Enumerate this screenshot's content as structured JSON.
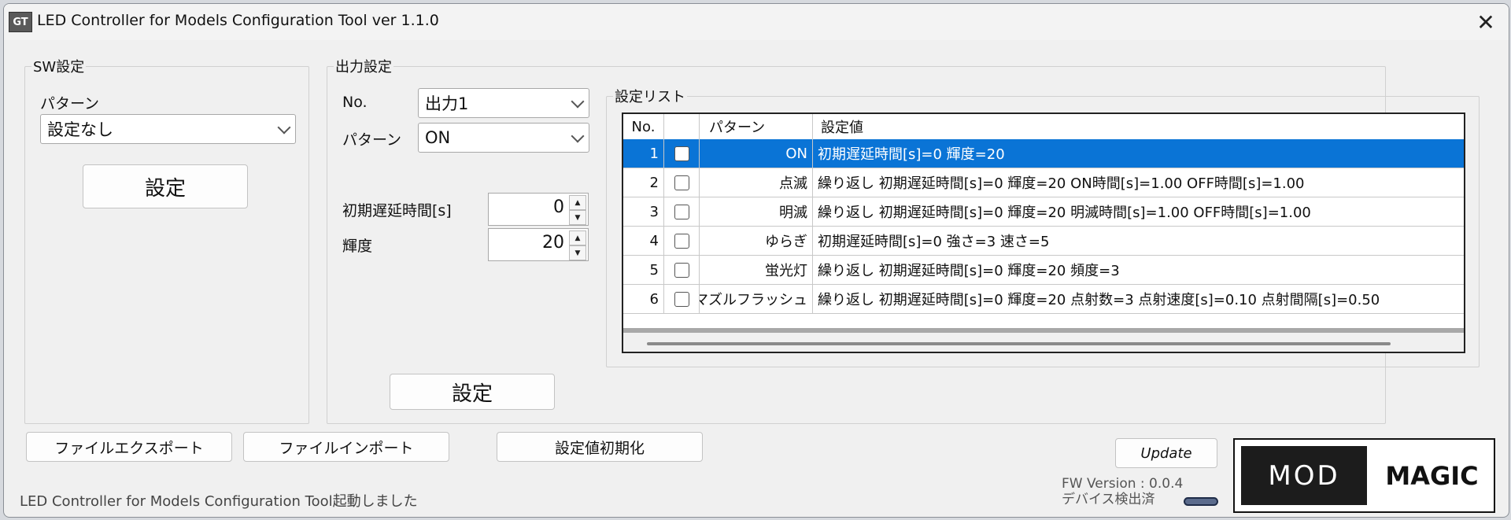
{
  "window": {
    "title": "LED Controller for Models Configuration Tool ver 1.1.0",
    "icon_label": "GT",
    "close_glyph": "✕"
  },
  "sw": {
    "group_label": "SW設定",
    "pattern_label": "パターン",
    "pattern_value": "設定なし",
    "set_button": "設定"
  },
  "output": {
    "group_label": "出力設定",
    "no_label": "No.",
    "no_value": "出力1",
    "pattern_label": "パターン",
    "pattern_value": "ON",
    "delay_label": "初期遅延時間[s]",
    "delay_value": "0",
    "brightness_label": "輝度",
    "brightness_value": "20",
    "set_button": "設定"
  },
  "list": {
    "group_label": "設定リスト",
    "headers": {
      "no": "No.",
      "check": "",
      "pattern": "パターン",
      "value": "設定値"
    },
    "rows": [
      {
        "no": "1",
        "pattern": "ON",
        "value": "初期遅延時間[s]=0 輝度=20",
        "checked": false
      },
      {
        "no": "2",
        "pattern": "点滅",
        "value": "繰り返し 初期遅延時間[s]=0 輝度=20 ON時間[s]=1.00 OFF時間[s]=1.00",
        "checked": false
      },
      {
        "no": "3",
        "pattern": "明滅",
        "value": "繰り返し 初期遅延時間[s]=0 輝度=20 明滅時間[s]=1.00 OFF時間[s]=1.00",
        "checked": false
      },
      {
        "no": "4",
        "pattern": "ゆらぎ",
        "value": "初期遅延時間[s]=0 強さ=3 速さ=5",
        "checked": false
      },
      {
        "no": "5",
        "pattern": "蛍光灯",
        "value": "繰り返し 初期遅延時間[s]=0 輝度=20 頻度=3",
        "checked": false
      },
      {
        "no": "6",
        "pattern": "マズルフラッシュ",
        "value": "繰り返し 初期遅延時間[s]=0 輝度=20 点射数=3 点射速度[s]=0.10 点射間隔[s]=0.50",
        "checked": false
      }
    ],
    "selected_row": 1
  },
  "actions": {
    "export": "ファイルエクスポート",
    "import": "ファイルインポート",
    "reset": "設定値初期化",
    "update": "Update"
  },
  "status": {
    "message": "LED Controller for Models Configuration Tool起動しました",
    "fw_version": "FW Version : 0.0.4",
    "device": "デバイス検出済"
  },
  "logo": {
    "left": "MOD",
    "right": "MAGIC"
  }
}
